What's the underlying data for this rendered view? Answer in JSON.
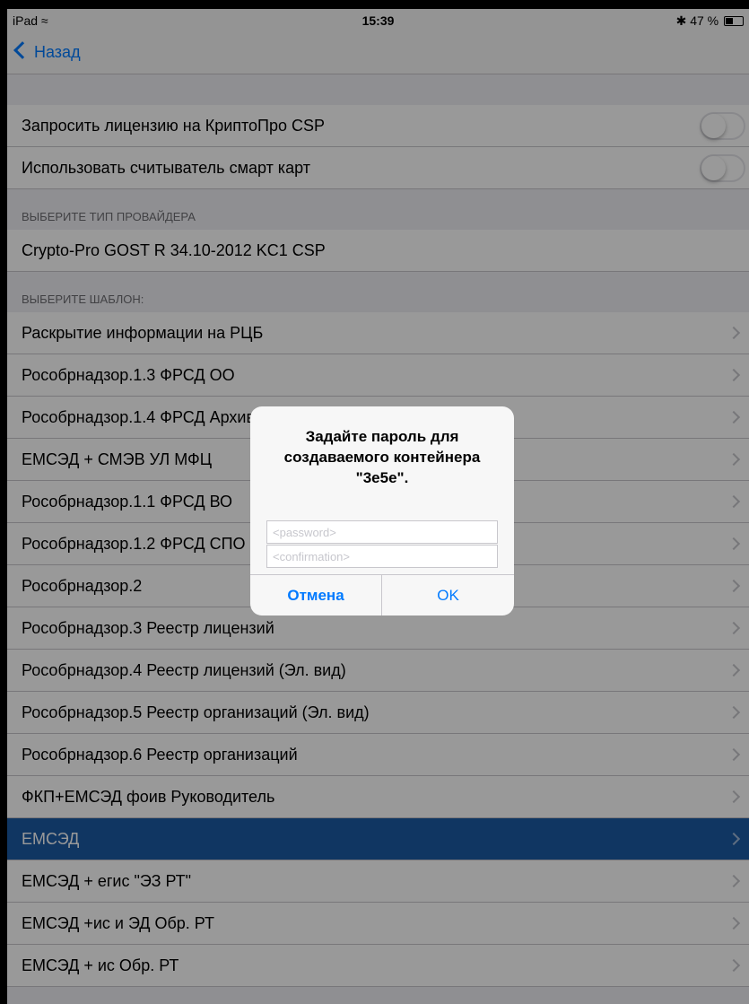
{
  "status_bar": {
    "device": "iPad",
    "time": "15:39",
    "bluetooth": "✱",
    "battery": "47 %",
    "battery_level": 0.47
  },
  "nav": {
    "back_label": "Назад"
  },
  "toggles": [
    {
      "label": "Запросить лицензию на КриптоПро CSP",
      "on": false
    },
    {
      "label": "Использовать считыватель смарт карт",
      "on": false
    }
  ],
  "provider_section": {
    "header": "ВЫБЕРИТЕ ТИП ПРОВАЙДЕРА",
    "value": "Crypto-Pro GOST R 34.10-2012 KC1 CSP"
  },
  "template_section": {
    "header": "ВЫБЕРИТЕ ШАБЛОН:",
    "items": [
      "Раскрытие информации на РЦБ",
      "Рособрнадзор.1.3 ФРСД ОО",
      "Рособрнадзор.1.4 ФРСД Архив",
      "ЕМСЭД + СМЭВ УЛ МФЦ",
      "Рособрнадзор.1.1 ФРСД ВО",
      "Рособрнадзор.1.2 ФРСД СПО",
      "Рособрнадзор.2",
      "Рособрнадзор.3 Реестр лицензий",
      "Рособрнадзор.4 Реестр лицензий (Эл. вид)",
      "Рособрнадзор.5 Реестр организаций (Эл. вид)",
      "Рособрнадзор.6 Реестр организаций",
      "ФКП+ЕМСЭД фоив Руководитель",
      "ЕМСЭД",
      "ЕМСЭД + егис \"ЭЗ РТ\"",
      "ЕМСЭД +ис и ЭД Обр. РТ",
      "ЕМСЭД + ис Обр. РТ"
    ],
    "selected_index": 12
  },
  "alert": {
    "title": "Задайте пароль для создаваемого контейнера \"3e5e\".",
    "password_placeholder": "<password>",
    "confirmation_placeholder": "<confirmation>",
    "cancel_label": "Отмена",
    "ok_label": "OK"
  },
  "colors": {
    "accent": "#007aff",
    "selected_row": "#1c5aa3"
  }
}
